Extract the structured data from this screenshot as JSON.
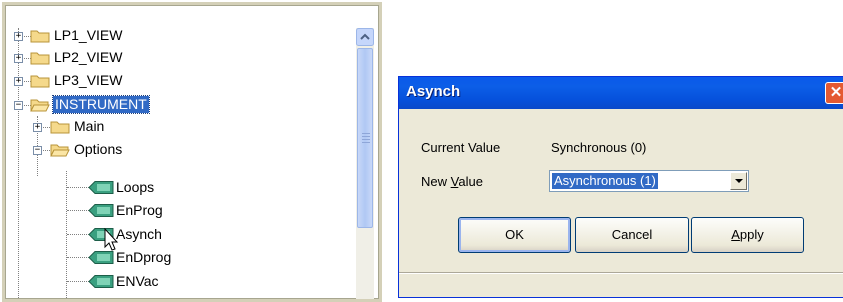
{
  "tree": {
    "items": [
      {
        "label": "LP1_VIEW"
      },
      {
        "label": "LP2_VIEW"
      },
      {
        "label": "LP3_VIEW"
      },
      {
        "label": "INSTRUMENT"
      },
      {
        "label": "Main"
      },
      {
        "label": "Options"
      },
      {
        "label": "Loops"
      },
      {
        "label": "EnProg"
      },
      {
        "label": "Asynch"
      },
      {
        "label": "EnDprog"
      },
      {
        "label": "ENVac"
      }
    ],
    "expand_plus": "+",
    "expand_minus": "−"
  },
  "dialog": {
    "title": "Asynch",
    "close_glyph": "✕",
    "current_value_label": "Current Value",
    "current_value": "Synchronous (0)",
    "new_value_label_pre": "New ",
    "new_value_label_underlined": "V",
    "new_value_label_post": "alue",
    "new_value_selected": "Asynchronous (1)",
    "ok_label": "OK",
    "cancel_label": "Cancel",
    "apply_label_underlined": "A",
    "apply_label_post": "pply"
  }
}
